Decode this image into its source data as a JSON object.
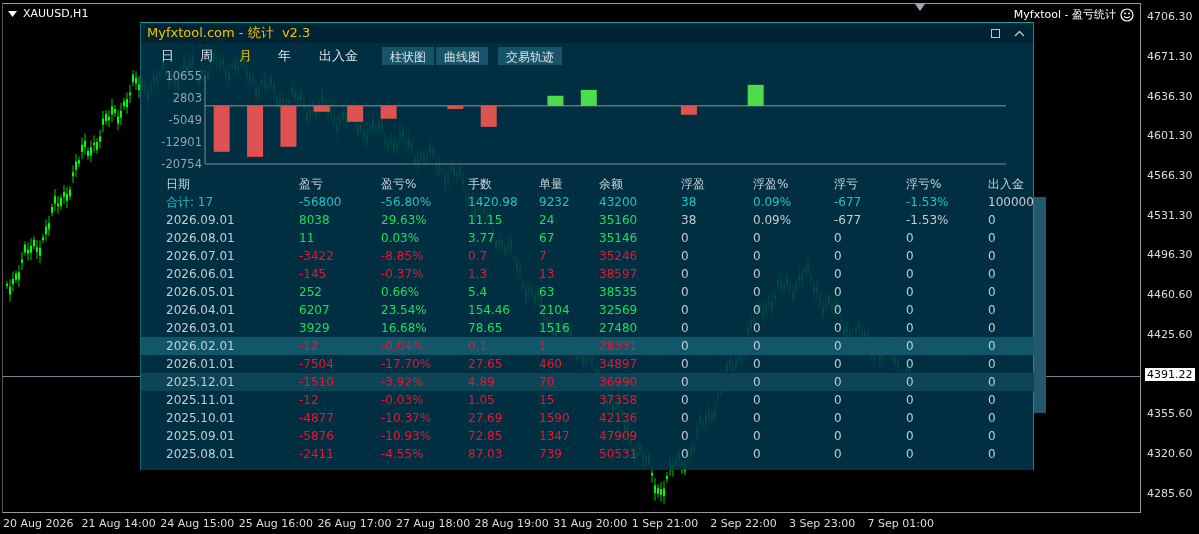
{
  "chart_header": {
    "symbol": "XAUUSD,H1",
    "indicator_name": "Myfxtool - 盈亏统计"
  },
  "panel": {
    "title": "Myfxtool.com - 统计  v2.3",
    "period_tabs": [
      {
        "label": "日",
        "selected": false
      },
      {
        "label": "周",
        "selected": false
      },
      {
        "label": "月",
        "selected": true
      },
      {
        "label": "年",
        "selected": false
      },
      {
        "label": "出入金",
        "selected": false
      }
    ],
    "view_buttons": [
      {
        "label": "柱状图"
      },
      {
        "label": "曲线图"
      },
      {
        "label": "交易轨迹"
      }
    ],
    "chart_data": {
      "type": "bar",
      "yticks": [
        10655,
        2803,
        -5049,
        -12901,
        -20754
      ],
      "ylim": [
        -20754,
        10655
      ],
      "values": [
        -16400,
        -18200,
        -14600,
        -2100,
        -5700,
        -4600,
        null,
        -1100,
        -7500,
        null,
        3600,
        5700,
        null,
        null,
        -3200,
        null,
        7500,
        null,
        null,
        null,
        null,
        null,
        null,
        null
      ]
    },
    "table": {
      "columns": [
        "日期",
        "盈亏",
        "盈亏%",
        "手数",
        "单量",
        "余额",
        "浮盈",
        "浮盈%",
        "浮亏",
        "浮亏%",
        "出入金"
      ],
      "rows": [
        {
          "kind": "total",
          "selected": false,
          "hovered": false,
          "cells": [
            "合计: 17",
            "-56800",
            "-56.80%",
            "1420.98",
            "9232",
            "43200",
            "38",
            "0.09%",
            "-677",
            "-1.53%",
            "100000"
          ]
        },
        {
          "kind": "profit",
          "selected": false,
          "hovered": false,
          "cells": [
            "2026.09.01",
            "8038",
            "29.63%",
            "11.15",
            "24",
            "35160",
            "38",
            "0.09%",
            "-677",
            "-1.53%",
            "0"
          ]
        },
        {
          "kind": "profit",
          "selected": false,
          "hovered": false,
          "cells": [
            "2026.08.01",
            "11",
            "0.03%",
            "3.77",
            "67",
            "35146",
            "0",
            "0",
            "0",
            "0",
            "0"
          ]
        },
        {
          "kind": "loss",
          "selected": false,
          "hovered": false,
          "cells": [
            "2026.07.01",
            "-3422",
            "-8.85%",
            "0.7",
            "7",
            "35246",
            "0",
            "0",
            "0",
            "0",
            "0"
          ]
        },
        {
          "kind": "loss",
          "selected": false,
          "hovered": false,
          "cells": [
            "2026.06.01",
            "-145",
            "-0.37%",
            "1.3",
            "13",
            "38597",
            "0",
            "0",
            "0",
            "0",
            "0"
          ]
        },
        {
          "kind": "profit",
          "selected": false,
          "hovered": false,
          "cells": [
            "2026.05.01",
            "252",
            "0.66%",
            "5.4",
            "63",
            "38535",
            "0",
            "0",
            "0",
            "0",
            "0"
          ]
        },
        {
          "kind": "profit",
          "selected": false,
          "hovered": false,
          "cells": [
            "2026.04.01",
            "6207",
            "23.54%",
            "154.46",
            "2104",
            "32569",
            "0",
            "0",
            "0",
            "0",
            "0"
          ]
        },
        {
          "kind": "profit",
          "selected": false,
          "hovered": false,
          "cells": [
            "2026.03.01",
            "3929",
            "16.68%",
            "78.65",
            "1516",
            "27480",
            "0",
            "0",
            "0",
            "0",
            "0"
          ]
        },
        {
          "kind": "loss",
          "selected": true,
          "hovered": false,
          "cells": [
            "2026.02.01",
            "-12",
            "-0.04%",
            "0.1",
            "1",
            "28331",
            "0",
            "0",
            "0",
            "0",
            "0"
          ]
        },
        {
          "kind": "loss",
          "selected": false,
          "hovered": false,
          "cells": [
            "2026.01.01",
            "-7504",
            "-17.70%",
            "27.65",
            "460",
            "34897",
            "0",
            "0",
            "0",
            "0",
            "0"
          ]
        },
        {
          "kind": "loss",
          "selected": false,
          "hovered": true,
          "cells": [
            "2025.12.01",
            "-1510",
            "-3.92%",
            "4.89",
            "70",
            "36990",
            "0",
            "0",
            "0",
            "0",
            "0"
          ]
        },
        {
          "kind": "loss",
          "selected": false,
          "hovered": false,
          "cells": [
            "2025.11.01",
            "-12",
            "-0.03%",
            "1.05",
            "15",
            "37358",
            "0",
            "0",
            "0",
            "0",
            "0"
          ]
        },
        {
          "kind": "loss",
          "selected": false,
          "hovered": false,
          "cells": [
            "2025.10.01",
            "-4877",
            "-10.37%",
            "27.69",
            "1590",
            "42136",
            "0",
            "0",
            "0",
            "0",
            "0"
          ]
        },
        {
          "kind": "loss",
          "selected": false,
          "hovered": false,
          "cells": [
            "2025.09.01",
            "-5876",
            "-10.93%",
            "72.85",
            "1347",
            "47909",
            "0",
            "0",
            "0",
            "0",
            "0"
          ]
        },
        {
          "kind": "loss",
          "selected": false,
          "hovered": false,
          "cells": [
            "2025.08.01",
            "-2411",
            "-4.55%",
            "87.03",
            "739",
            "50531",
            "0",
            "0",
            "0",
            "0",
            "0"
          ]
        }
      ]
    }
  },
  "price_axis": [
    {
      "label": "4706.30",
      "kind": "tick"
    },
    {
      "label": "4671.30",
      "kind": "tick"
    },
    {
      "label": "4636.30",
      "kind": "tick"
    },
    {
      "label": "4601.30",
      "kind": "tick"
    },
    {
      "label": "4566.30",
      "kind": "tick"
    },
    {
      "label": "4531.30",
      "kind": "tick"
    },
    {
      "label": "4496.30",
      "kind": "tick"
    },
    {
      "label": "4460.60",
      "kind": "tick"
    },
    {
      "label": "4425.60",
      "kind": "tick"
    },
    {
      "label": "4391.22",
      "kind": "current"
    },
    {
      "label": "4355.60",
      "kind": "tick"
    },
    {
      "label": "4320.60",
      "kind": "tick"
    },
    {
      "label": "4285.60",
      "kind": "tick"
    }
  ],
  "time_axis": [
    "20 Aug 2026",
    "21 Aug 14:00",
    "24 Aug 15:00",
    "25 Aug 16:00",
    "26 Aug 17:00",
    "27 Aug 18:00",
    "28 Aug 19:00",
    "31 Aug 20:00",
    "1 Sep 21:00",
    "2 Sep 22:00",
    "3 Sep 23:00",
    "7 Sep 01:00"
  ]
}
